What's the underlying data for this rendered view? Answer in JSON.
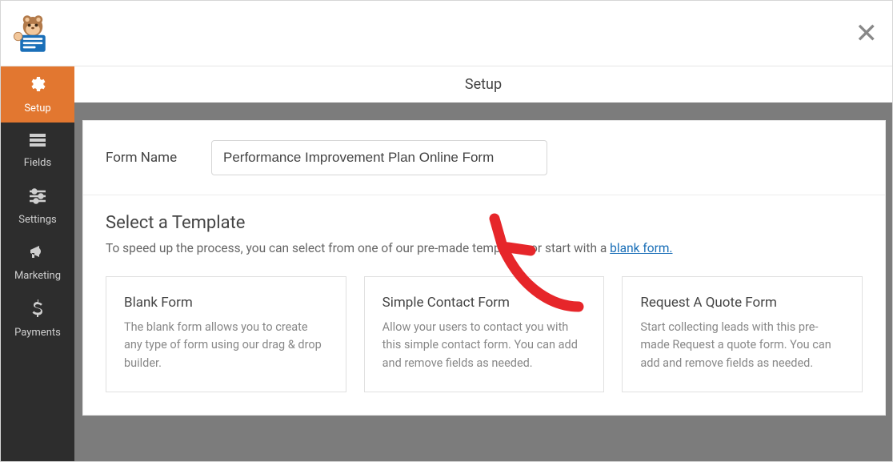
{
  "panel_title": "Setup",
  "close_glyph": "✕",
  "sidebar": {
    "items": [
      {
        "label": "Setup"
      },
      {
        "label": "Fields"
      },
      {
        "label": "Settings"
      },
      {
        "label": "Marketing"
      },
      {
        "label": "Payments"
      }
    ]
  },
  "form_name": {
    "label": "Form Name",
    "value": "Performance Improvement Plan Online Form"
  },
  "select_template": {
    "heading": "Select a Template",
    "lead_before": "To speed up the process, you can select from one of our pre-made templates or start with a ",
    "lead_link": "blank form.",
    "templates": [
      {
        "title": "Blank Form",
        "desc": "The blank form allows you to create any type of form using our drag & drop builder."
      },
      {
        "title": "Simple Contact Form",
        "desc": "Allow your users to contact you with this simple contact form. You can add and remove fields as needed."
      },
      {
        "title": "Request A Quote Form",
        "desc": "Start collecting leads with this pre-made Request a quote form. You can add and remove fields as needed."
      }
    ]
  }
}
